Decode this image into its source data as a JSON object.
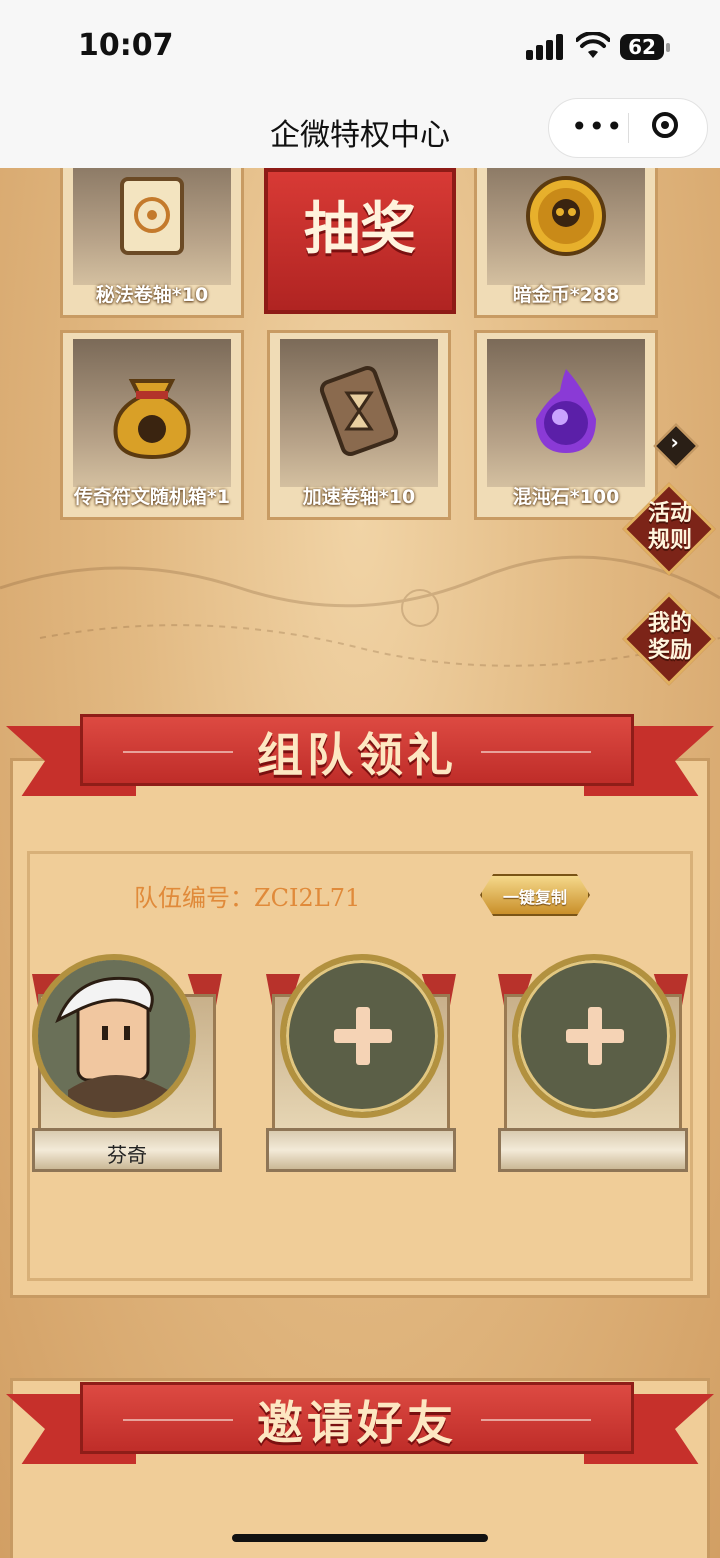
{
  "status_bar": {
    "time": "10:07",
    "battery": "62"
  },
  "nav": {
    "title": "企微特权中心",
    "more_icon": "more-icon",
    "close_icon": "target-icon"
  },
  "prizes": [
    {
      "label": "秘法卷轴*10",
      "icon": "scroll-icon"
    },
    {
      "label": "暗金币*288",
      "icon": "skull-coin-icon"
    },
    {
      "label": "传奇符文随机箱*1",
      "icon": "rune-bag-icon"
    },
    {
      "label": "加速卷轴*10",
      "icon": "hourglass-scroll-icon"
    },
    {
      "label": "混沌石*100",
      "icon": "chaos-stone-icon"
    }
  ],
  "draw_button": {
    "label": "抽奖"
  },
  "side": {
    "rules": "活动\n规则",
    "rewards": "我的\n奖励"
  },
  "team": {
    "banner": "组队领礼",
    "id_label": "队伍编号：ZCI2L71",
    "copy_button": "一键复制",
    "members": [
      {
        "name": "芬奇",
        "filled": true
      },
      {
        "name": "",
        "filled": false
      },
      {
        "name": "",
        "filled": false
      }
    ]
  },
  "invite": {
    "banner": "邀请好友"
  },
  "colors": {
    "accent_red": "#c6302b",
    "parchment": "#f0cd98",
    "gold": "#b2913f"
  }
}
